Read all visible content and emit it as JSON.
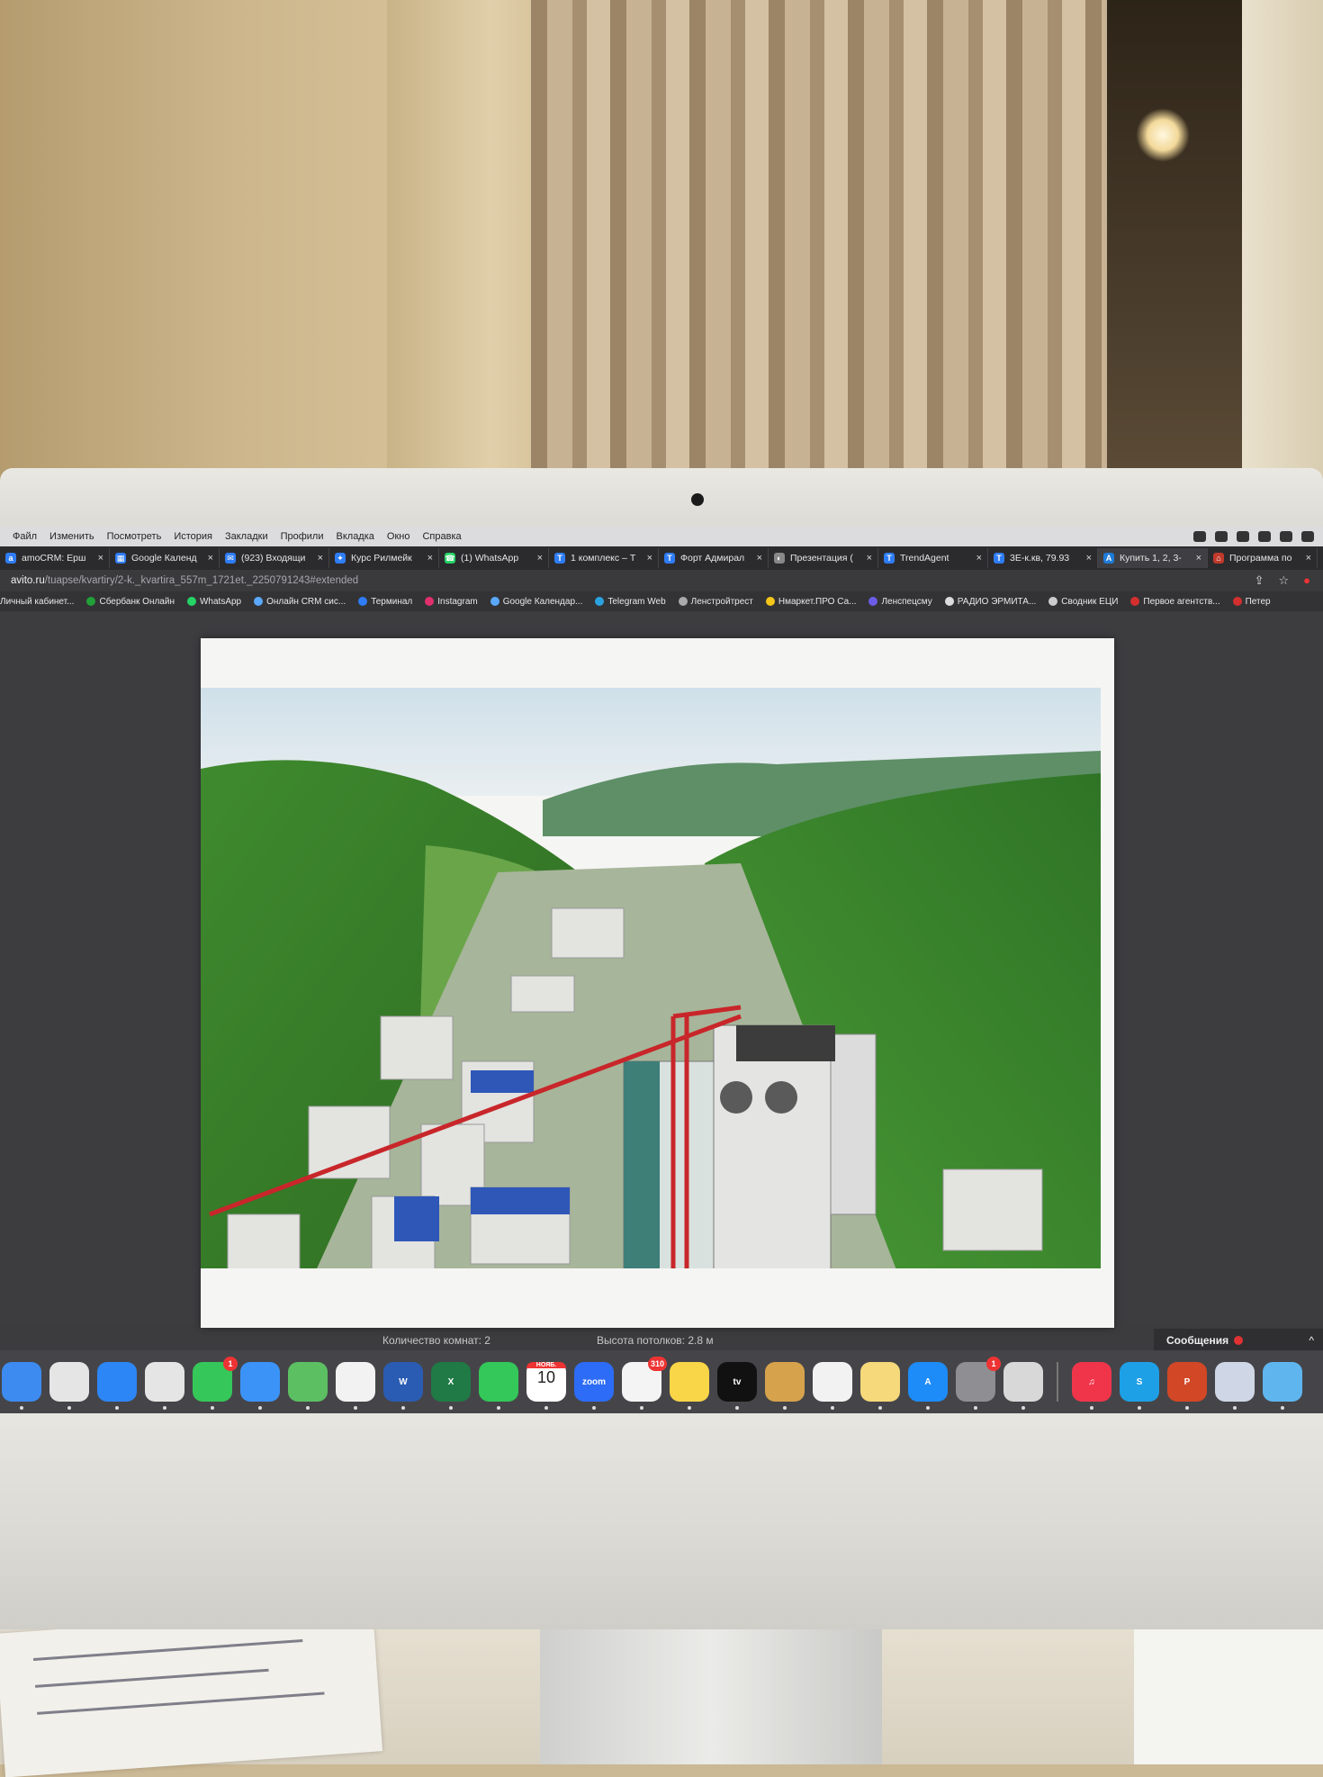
{
  "colors": {
    "tab_bar": "#2b2b2e",
    "page_background": "#3d3d40",
    "badge_red": "#e33333",
    "accent_blue": "#2f7df6"
  },
  "menubar": {
    "items": [
      "Файл",
      "Изменить",
      "Посмотреть",
      "История",
      "Закладки",
      "Профили",
      "Вкладка",
      "Окно",
      "Справка"
    ]
  },
  "tabs": [
    {
      "label": "amoCRM: Ерш",
      "icon": "amocrm-icon"
    },
    {
      "label": "Google Календ",
      "icon": "calendar-icon"
    },
    {
      "label": "(923) Входящи",
      "icon": "mail-icon"
    },
    {
      "label": "Курс Рилмейк",
      "icon": "course-icon"
    },
    {
      "label": "(1) WhatsApp",
      "icon": "whatsapp-icon"
    },
    {
      "label": "1 комплекс – Т",
      "icon": "telegraph-icon"
    },
    {
      "label": "Форт Адмирал",
      "icon": "telegraph-icon"
    },
    {
      "label": "Презентация (",
      "icon": "presentation-icon"
    },
    {
      "label": "TrendAgent",
      "icon": "telegraph-icon"
    },
    {
      "label": "3Е-к.кв, 79.93",
      "icon": "telegraph-icon"
    },
    {
      "label": "Купить 1, 2, 3-",
      "icon": "avito-icon"
    },
    {
      "label": "Программа по",
      "icon": "program-icon"
    }
  ],
  "address": {
    "host": "avito.ru",
    "path": "/tuapse/kvartiry/2-k._kvartira_557m_1721et._2250791243#extended"
  },
  "bookmarks": [
    "Личный кабинет...",
    "Сбербанк Онлайн",
    "WhatsApp",
    "Онлайн CRM сис...",
    "Терминал",
    "Instagram",
    "Google Календар...",
    "Telegram Web",
    "Ленстройтрест",
    "Нмаркет.ПРО Са...",
    "Ленспецсму",
    "РАДИО ЭРМИТА...",
    "Сводник ЕЦИ",
    "Первое агентств...",
    "Петер"
  ],
  "viewer": {
    "close_icon": "×",
    "prev_icon": "‹",
    "next_icon": "›"
  },
  "listing": {
    "rooms": "Количество комнат: 2",
    "ceiling": "Высота потолков: 2.8 м"
  },
  "messages": {
    "label": "Сообщения",
    "toggle_icon": "^"
  },
  "dock": {
    "apps": [
      {
        "name": "finder",
        "label": "",
        "color": "#3d8bf0"
      },
      {
        "name": "launchpad",
        "label": "",
        "color": "#e5e5e5"
      },
      {
        "name": "safari",
        "label": "",
        "color": "#2c86f5"
      },
      {
        "name": "chrome",
        "label": "",
        "color": "#e5e5e5"
      },
      {
        "name": "messages",
        "label": "",
        "color": "#35c759",
        "badge": "1"
      },
      {
        "name": "mail",
        "label": "",
        "color": "#3b93f7"
      },
      {
        "name": "maps",
        "label": "",
        "color": "#5cbf62"
      },
      {
        "name": "photos",
        "label": "",
        "color": "#f2f2f2"
      },
      {
        "name": "word",
        "label": "W",
        "color": "#2b5cb3"
      },
      {
        "name": "excel",
        "label": "X",
        "color": "#1f7a45"
      },
      {
        "name": "facetime",
        "label": "",
        "color": "#34c759"
      },
      {
        "name": "calendar",
        "label": "10",
        "color": "#ffffff",
        "month": "НОЯБ."
      },
      {
        "name": "zoom",
        "label": "zoom",
        "color": "#2d6cf6"
      },
      {
        "name": "reminders",
        "label": "",
        "color": "#f4f4f4",
        "badge": "310"
      },
      {
        "name": "notes",
        "label": "",
        "color": "#f9d548"
      },
      {
        "name": "apple-tv",
        "label": "tv",
        "color": "#111111"
      },
      {
        "name": "contacts",
        "label": "",
        "color": "#d6a24c"
      },
      {
        "name": "numbers",
        "label": "",
        "color": "#f2f2f2"
      },
      {
        "name": "pages",
        "label": "",
        "color": "#f5d97a"
      },
      {
        "name": "app-store",
        "label": "A",
        "color": "#1d8cf8"
      },
      {
        "name": "system-settings",
        "label": "",
        "color": "#8e8e93",
        "badge": "1"
      },
      {
        "name": "calculator",
        "label": "",
        "color": "#d8d8d8"
      },
      {
        "name": "music",
        "label": "♫",
        "color": "#f0354a"
      },
      {
        "name": "skype",
        "label": "S",
        "color": "#1ea0e6"
      },
      {
        "name": "powerpoint",
        "label": "P",
        "color": "#d24726"
      },
      {
        "name": "preview",
        "label": "",
        "color": "#cfd7e6"
      },
      {
        "name": "folder",
        "label": "",
        "color": "#5fb6ef"
      }
    ]
  }
}
